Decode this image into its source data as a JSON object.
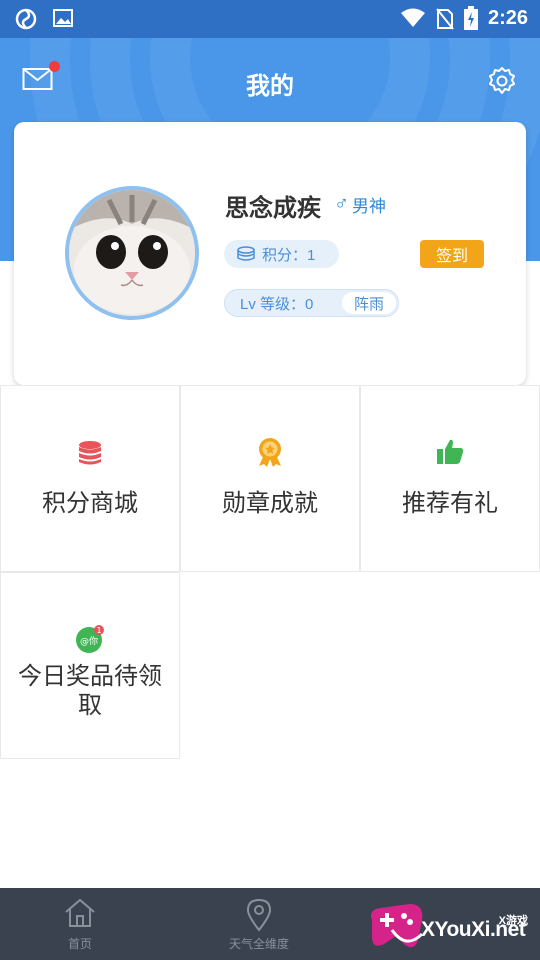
{
  "status_bar": {
    "time": "2:26"
  },
  "header": {
    "title": "我的"
  },
  "profile": {
    "username": "思念成疾",
    "gender_symbol": "♂",
    "gender_label": "男神",
    "points": "积分：1",
    "checkin_label": "签到",
    "level": "Lv 等级：0",
    "rank": "阵雨"
  },
  "grid": [
    {
      "label": "积分商城",
      "icon": "coin-stack-icon"
    },
    {
      "label": "勋章成就",
      "icon": "medal-icon"
    },
    {
      "label": "推荐有礼",
      "icon": "thumbs-up-icon"
    },
    {
      "label_line1": "今日奖品待领",
      "label_line2": "取",
      "icon": "gift-notification-icon",
      "badge": "1",
      "badge_icon_text": "@你"
    }
  ],
  "bottom_nav": [
    {
      "label": "首页",
      "icon": "home-icon"
    },
    {
      "label": "天气全维度",
      "icon": "location-pin-icon"
    }
  ],
  "watermark": {
    "text": "XYouXi.net",
    "small": "X游戏"
  },
  "colors": {
    "header_bg": "#4a97ea",
    "status_bg": "#2f6fc4",
    "accent": "#f3a51a",
    "pill_text": "#4a8fd8"
  }
}
